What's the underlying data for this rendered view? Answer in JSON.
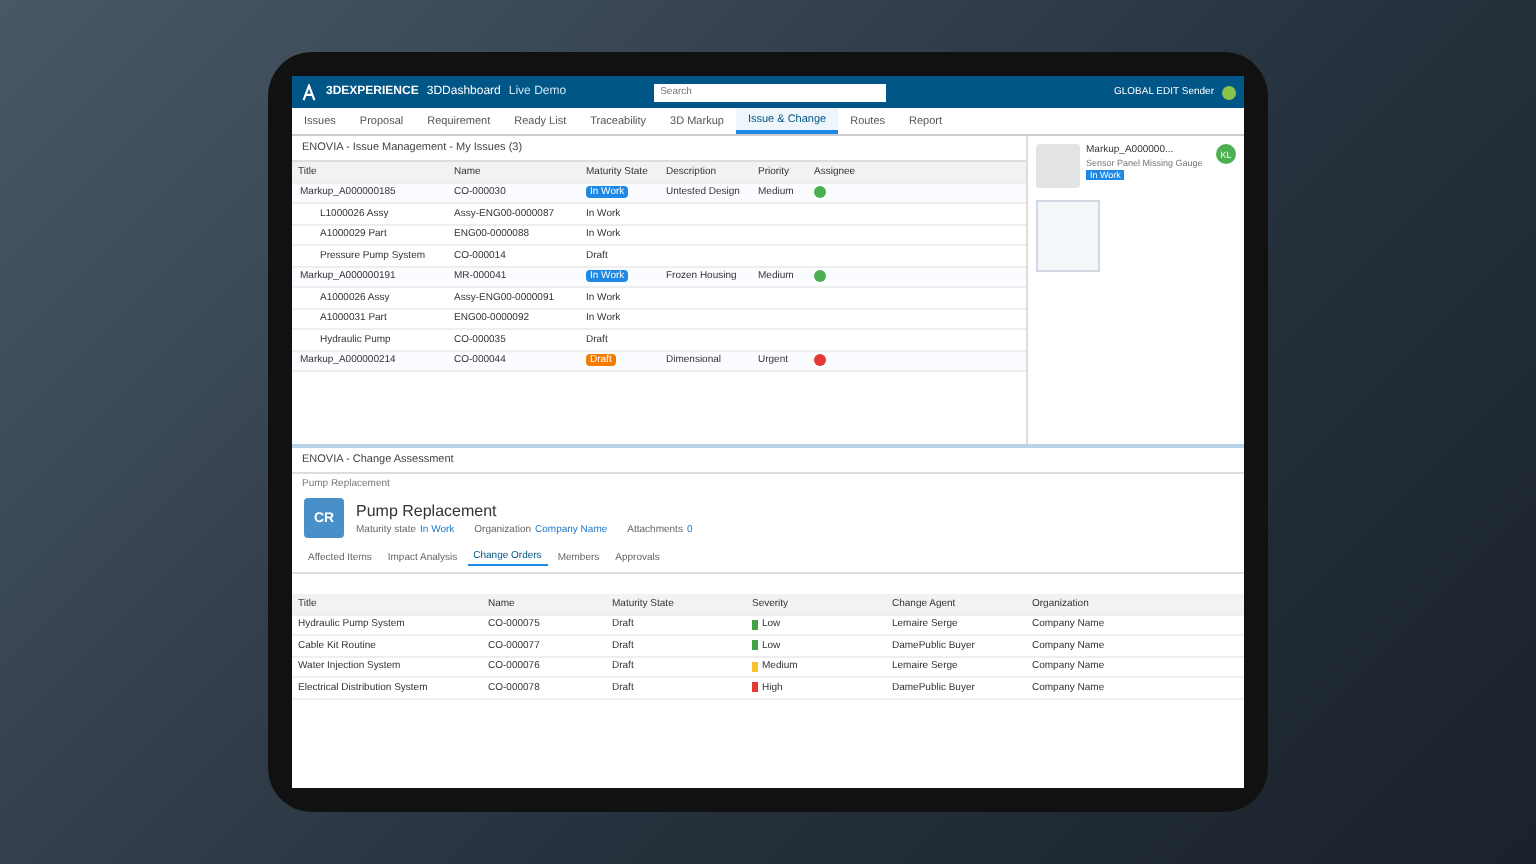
{
  "topbar": {
    "brand": "3DEXPERIENCE",
    "app": "3DDashboard",
    "space": "Live Demo",
    "search": {
      "placeholder": "Search"
    },
    "user": "GLOBAL EDIT Sender"
  },
  "tabs": [
    {
      "label": "Issues",
      "selected": false
    },
    {
      "label": "Proposal",
      "selected": false
    },
    {
      "label": "Requirement",
      "selected": false
    },
    {
      "label": "Ready List",
      "selected": false
    },
    {
      "label": "Traceability",
      "selected": false
    },
    {
      "label": "3D Markup",
      "selected": false
    },
    {
      "label": "Issue & Change",
      "selected": true
    },
    {
      "label": "Routes",
      "selected": false
    },
    {
      "label": "Report",
      "selected": false
    }
  ],
  "issue_panel": {
    "title": "ENOVIA - Issue Management - My Issues (3)",
    "columns": [
      "Title",
      "Name",
      "Maturity State",
      "Description",
      "Priority",
      "Assignee"
    ],
    "rows": [
      {
        "title": "Markup_A000000185",
        "name": "CO-000030",
        "state": "In Work",
        "color": "#1e88e5",
        "description": "Untested Design",
        "priority": "Medium",
        "assignee": {
          "color": "#4caf50"
        },
        "children": [
          {
            "title": "L1000026 Assy",
            "name": "Assy-ENG00-0000087",
            "state": "In Work"
          },
          {
            "title": "A1000029 Part",
            "name": "ENG00-0000088",
            "state": "In Work"
          },
          {
            "title": "Pressure Pump System",
            "name": "CO-000014",
            "state": "Draft"
          }
        ]
      },
      {
        "title": "Markup_A000000191",
        "name": "MR-000041",
        "state": "In Work",
        "color": "#1e88e5",
        "description": "Frozen Housing",
        "priority": "Medium",
        "assignee": {
          "color": "#4caf50"
        },
        "children": [
          {
            "title": "A1000026 Assy",
            "name": "Assy-ENG00-0000091",
            "state": "In Work"
          },
          {
            "title": "A1000031 Part",
            "name": "ENG00-0000092",
            "state": "In Work"
          },
          {
            "title": "Hydraulic Pump",
            "name": "CO-000035",
            "state": "Draft"
          }
        ]
      },
      {
        "title": "Markup_A000000214",
        "name": "CO-000044",
        "state": "Draft",
        "color": "#f57c00",
        "description": "Dimensional",
        "priority": "Urgent",
        "assignee": {
          "color": "#e53935"
        },
        "children": []
      }
    ]
  },
  "markup": {
    "title": "Markup_A000000...",
    "subtitle": "Sensor Panel Missing Gauge",
    "state": "In Work",
    "initials": "KL"
  },
  "change_panel": {
    "title": "ENOVIA - Change Assessment",
    "breadcrumb": "Pump Replacement",
    "icon_label": "CR",
    "name": "Pump Replacement",
    "fields": [
      {
        "label": "Maturity state",
        "value": "In Work"
      },
      {
        "label": "Organization",
        "value": "Company Name"
      },
      {
        "label": "Attachments",
        "value": "0"
      }
    ],
    "subtabs": [
      {
        "label": "Affected Items",
        "selected": false
      },
      {
        "label": "Impact Analysis",
        "selected": false
      },
      {
        "label": "Change Orders",
        "selected": true
      },
      {
        "label": "Members",
        "selected": false
      },
      {
        "label": "Approvals",
        "selected": false
      }
    ],
    "columns": [
      "Title",
      "Name",
      "Maturity State",
      "Severity",
      "Change Agent",
      "Organization"
    ],
    "rows": [
      {
        "title": "Hydraulic Pump System",
        "name": "CO-000075",
        "state": "Draft",
        "severity": "Low",
        "color": "#43a047",
        "agent": "Lemaire Serge",
        "org": "Company Name"
      },
      {
        "title": "Cable Kit Routine",
        "name": "CO-000077",
        "state": "Draft",
        "severity": "Low",
        "color": "#43a047",
        "agent": "DamePublic Buyer",
        "org": "Company Name"
      },
      {
        "title": "Water Injection System",
        "name": "CO-000076",
        "state": "Draft",
        "severity": "Medium",
        "color": "#fbc02d",
        "agent": "Lemaire Serge",
        "org": "Company Name"
      },
      {
        "title": "Electrical Distribution System",
        "name": "CO-000078",
        "state": "Draft",
        "severity": "High",
        "color": "#e53935",
        "agent": "DamePublic Buyer",
        "org": "Company Name"
      }
    ]
  }
}
